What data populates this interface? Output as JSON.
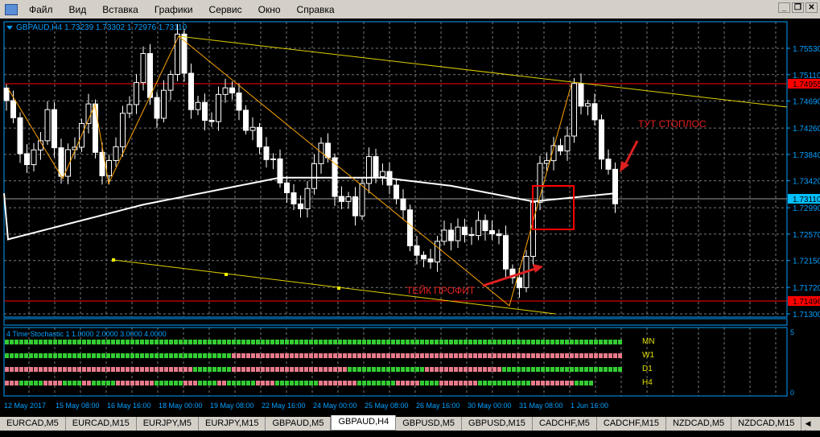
{
  "menu": {
    "items": [
      "Файл",
      "Вид",
      "Вставка",
      "Графики",
      "Сервис",
      "Окно",
      "Справка"
    ]
  },
  "chart_header": {
    "symbol": "GBPAUD,H4",
    "ohlc": "1.73239 1.73302 1.72976 1.73110"
  },
  "price_axis": {
    "labels": [
      "1.75530",
      "1.75110",
      "1.74690",
      "1.74260",
      "1.73840",
      "1.73420",
      "1.72990",
      "1.72570",
      "1.72150",
      "1.71720",
      "1.71300"
    ],
    "levels": [
      1.7553,
      1.7511,
      1.7469,
      1.7426,
      1.7384,
      1.7342,
      1.7299,
      1.7257,
      1.7215,
      1.7172,
      1.713
    ],
    "range": [
      1.713,
      1.7553
    ]
  },
  "lines": {
    "resistance": {
      "label": "1.74955",
      "price": 1.74955
    },
    "support": {
      "label": "1.71496",
      "price": 1.71496
    },
    "current": {
      "label": "1.73110",
      "price": 1.7311
    }
  },
  "annotations": {
    "stop": "ТУТ СТОПЛОС",
    "take": "ТЕЙК ПРОФИТ"
  },
  "colors": {
    "bull": "#000000",
    "bear": "#ffffff",
    "grid": "#888888",
    "axis": "#00a0ff",
    "ma": "#ffffff",
    "zigzag": "#ffa500",
    "channel": "#ffff00",
    "level": "#ff0000",
    "green": "#33cc33",
    "red": "#e87b8b"
  },
  "chart_data": {
    "type": "candlestick",
    "candle_count": 90,
    "close_path": [
      [
        0,
        1.74697
      ],
      [
        3,
        1.73607
      ],
      [
        6,
        1.7444
      ],
      [
        8,
        1.73543
      ],
      [
        12,
        1.74569
      ],
      [
        14,
        1.73415
      ],
      [
        20,
        1.75338
      ],
      [
        22,
        1.74376
      ],
      [
        25,
        1.75658
      ],
      [
        27,
        1.74633
      ],
      [
        30,
        1.74376
      ],
      [
        32,
        1.75017
      ],
      [
        34,
        1.74504
      ],
      [
        37,
        1.73992
      ],
      [
        40,
        1.73479
      ],
      [
        42,
        1.72966
      ],
      [
        44,
        1.73222
      ],
      [
        46,
        1.7412
      ],
      [
        48,
        1.73222
      ],
      [
        51,
        1.72966
      ],
      [
        53,
        1.73735
      ],
      [
        57,
        1.73222
      ],
      [
        59,
        1.72453
      ],
      [
        61,
        1.72069
      ],
      [
        64,
        1.72581
      ],
      [
        67,
        1.72581
      ],
      [
        70,
        1.7271
      ],
      [
        72,
        1.72453
      ],
      [
        74,
        1.71812
      ],
      [
        75,
        1.71684
      ],
      [
        77,
        1.72966
      ],
      [
        78,
        1.73735
      ],
      [
        80,
        1.73863
      ],
      [
        82,
        1.7412
      ],
      [
        83,
        1.74889
      ],
      [
        85,
        1.74569
      ],
      [
        86,
        1.74376
      ],
      [
        87,
        1.73863
      ],
      [
        89,
        1.7311
      ]
    ],
    "ma_path": [
      [
        0,
        1.7248
      ],
      [
        20,
        1.7304
      ],
      [
        40,
        1.7347
      ],
      [
        55,
        1.7347
      ],
      [
        65,
        1.7334
      ],
      [
        77,
        1.7309
      ],
      [
        89,
        1.7322
      ]
    ]
  },
  "indicator": {
    "title": "4 Time Stochastic 1 1.0000 2.0000 3.0000 4.0000",
    "scale_max": "5",
    "scale_min": "0",
    "rows": [
      {
        "label": "MN",
        "runs": [
          [
            "G",
            128
          ]
        ]
      },
      {
        "label": "W1",
        "runs": [
          [
            "G",
            47
          ],
          [
            "R",
            81
          ]
        ]
      },
      {
        "label": "D1",
        "runs": [
          [
            "R",
            39
          ],
          [
            "G",
            8
          ],
          [
            "R",
            24
          ],
          [
            "G",
            16
          ],
          [
            "R",
            16
          ],
          [
            "G",
            25
          ]
        ]
      },
      {
        "label": "H4",
        "runs": [
          [
            "R",
            3
          ],
          [
            "G",
            5
          ],
          [
            "R",
            4
          ],
          [
            "G",
            4
          ],
          [
            "R",
            2
          ],
          [
            "G",
            5
          ],
          [
            "R",
            8
          ],
          [
            "G",
            6
          ],
          [
            "R",
            3
          ],
          [
            "G",
            4
          ],
          [
            "R",
            2
          ],
          [
            "G",
            6
          ],
          [
            "R",
            4
          ],
          [
            "G",
            9
          ],
          [
            "R",
            8
          ],
          [
            "G",
            8
          ],
          [
            "R",
            5
          ],
          [
            "G",
            4
          ],
          [
            "R",
            8
          ],
          [
            "G",
            11
          ],
          [
            "R",
            9
          ],
          [
            "G",
            4
          ]
        ]
      }
    ]
  },
  "time_axis": {
    "labels": [
      "12 May 2017",
      "15 May 08:00",
      "16 May 16:00",
      "18 May 00:00",
      "19 May 08:00",
      "22 May 16:00",
      "24 May 00:00",
      "25 May 08:00",
      "26 May 16:00",
      "30 May 00:00",
      "31 May 08:00",
      "1 Jun 16:00"
    ]
  },
  "tabs": [
    "EURCAD,M5",
    "EURCAD,M15",
    "EURJPY,M5",
    "EURJPY,M15",
    "GBPAUD,M5",
    "GBPAUD,H4",
    "GBPUSD,M5",
    "GBPUSD,M15",
    "CADCHF,M5",
    "CADCHF,M15",
    "NZDCAD,M5",
    "NZDCAD,M15"
  ],
  "active_tab": 5
}
